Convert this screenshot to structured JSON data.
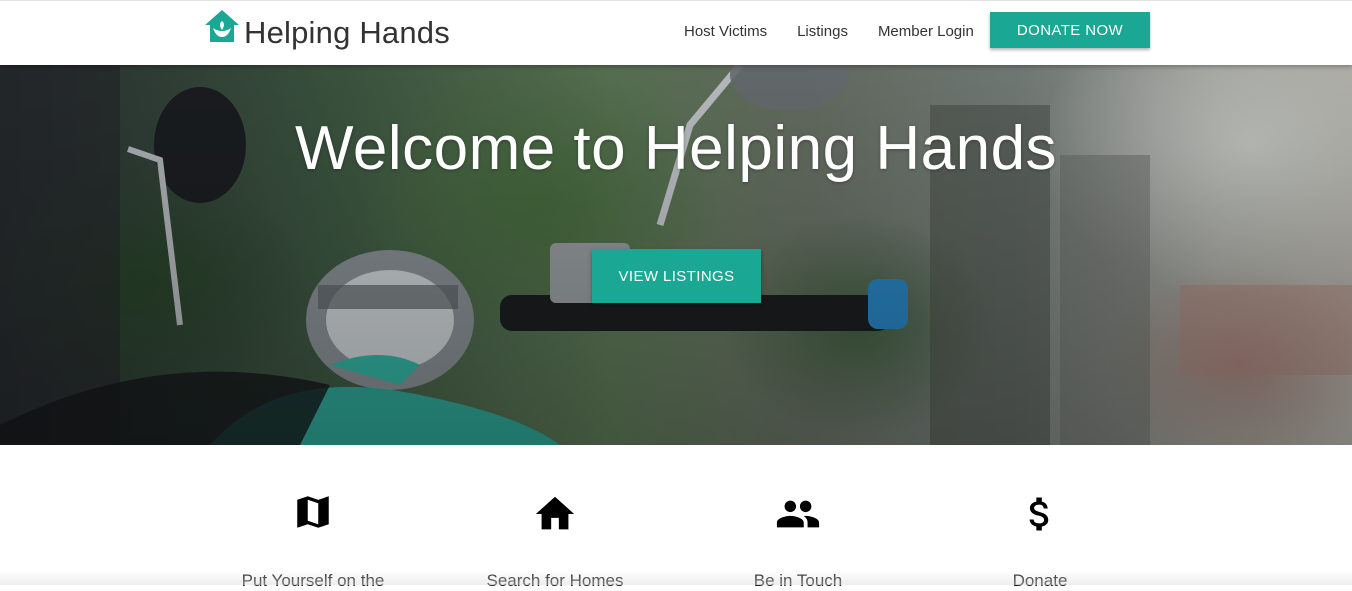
{
  "brand": {
    "name": "Helping Hands",
    "logo_icon": "house-hands-icon",
    "accent": "#1aa895"
  },
  "nav": {
    "links": [
      "Host Victims",
      "Listings",
      "Member Login"
    ],
    "donate_label": "DONATE NOW"
  },
  "hero": {
    "title": "Welcome to Helping Hands",
    "cta_label": "VIEW LISTINGS",
    "background": "motorbike-photo"
  },
  "features": [
    {
      "icon": "map-icon",
      "label": "Put Yourself on the"
    },
    {
      "icon": "home-icon",
      "label": "Search for Homes"
    },
    {
      "icon": "people-icon",
      "label": "Be in Touch"
    },
    {
      "icon": "dollar-icon",
      "label": "Donate"
    }
  ]
}
